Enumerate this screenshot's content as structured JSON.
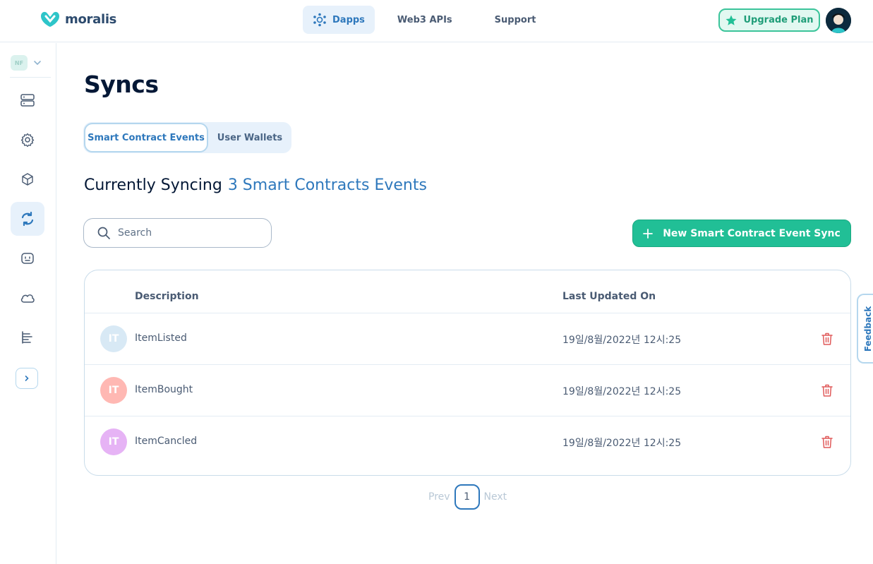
{
  "brand": {
    "name": "moralis"
  },
  "nav": {
    "items": [
      {
        "label": "Dapps",
        "icon": "dapps-icon",
        "active": true
      },
      {
        "label": "Web3 APIs",
        "active": false
      },
      {
        "label": "Support",
        "active": false
      }
    ],
    "upgrade_label": "Upgrade Plan"
  },
  "sidebar": {
    "org_initials": "NF",
    "items": [
      {
        "icon": "servers-icon",
        "active": false
      },
      {
        "icon": "settings-gear-icon",
        "active": false
      },
      {
        "icon": "cube-icon",
        "active": false
      },
      {
        "icon": "sync-icon",
        "active": true
      },
      {
        "icon": "plugin-icon",
        "active": false
      },
      {
        "icon": "cloud-icon",
        "active": false
      },
      {
        "icon": "logs-chart-icon",
        "active": false
      }
    ]
  },
  "page": {
    "title": "Syncs",
    "tabs": [
      {
        "label": "Smart Contract Events",
        "active": true
      },
      {
        "label": "User Wallets",
        "active": false
      }
    ],
    "syncing_label": "Currently Syncing",
    "syncing_count": "3 Smart Contracts Events",
    "search_placeholder": "Search",
    "new_button_label": "New Smart Contract Event Sync"
  },
  "table": {
    "headers": {
      "description": "Description",
      "updated": "Last Updated On"
    },
    "rows": [
      {
        "initials": "IT",
        "color": "#d8e9f5",
        "description": "ItemListed",
        "updated": "19일/8월/2022년 12시:25"
      },
      {
        "initials": "IT",
        "color": "#ffb8b3",
        "description": "ItemBought",
        "updated": "19일/8월/2022년 12시:25"
      },
      {
        "initials": "IT",
        "color": "#e6b3f5",
        "description": "ItemCancled",
        "updated": "19일/8월/2022년 12시:25"
      }
    ]
  },
  "pagination": {
    "prev": "Prev",
    "current": "1",
    "next": "Next"
  },
  "feedback_label": "Feedback",
  "colors": {
    "primary": "#2e78bc",
    "accent_green": "#21bf96",
    "danger": "#e05a5a"
  }
}
